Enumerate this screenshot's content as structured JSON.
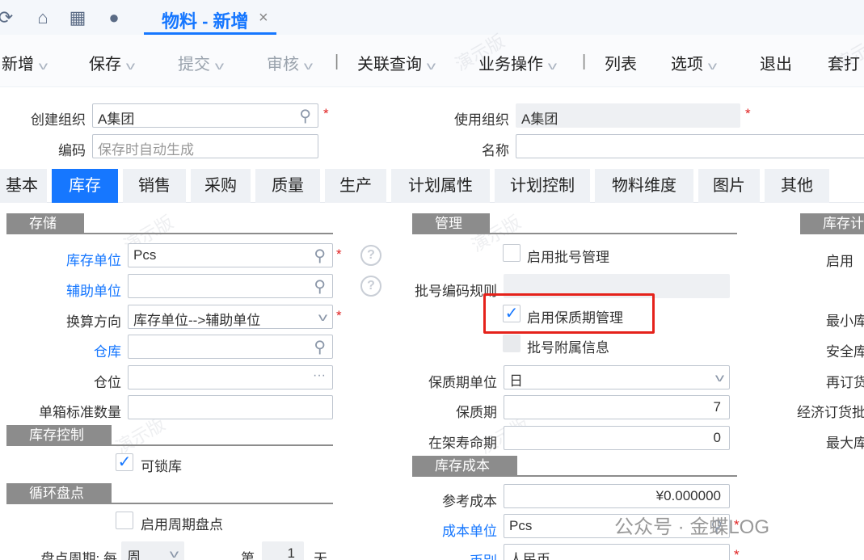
{
  "topbar": {
    "icons": [
      "refresh-icon",
      "home-icon",
      "apps-icon",
      "message-icon"
    ],
    "tab_title": "物料 - 新增",
    "tab_close": "×"
  },
  "toolbar": {
    "new": "新增",
    "save": "保存",
    "submit": "提交",
    "audit": "审核",
    "related_query": "关联查询",
    "business_ops": "业务操作",
    "list": "列表",
    "options": "选项",
    "exit": "退出",
    "print": "套打"
  },
  "header_form": {
    "create_org_label": "创建组织",
    "create_org_value": "A集团",
    "use_org_label": "使用组织",
    "use_org_value": "A集团",
    "code_label": "编码",
    "code_placeholder": "保存时自动生成",
    "name_label": "名称",
    "name_value": ""
  },
  "tabs": [
    "基本",
    "库存",
    "销售",
    "采购",
    "质量",
    "生产",
    "计划属性",
    "计划控制",
    "物料维度",
    "图片",
    "其他"
  ],
  "active_tab": "库存",
  "storage": {
    "title": "存储",
    "stock_unit_label": "库存单位",
    "stock_unit_value": "Pcs",
    "aux_unit_label": "辅助单位",
    "aux_unit_value": "",
    "convert_dir_label": "换算方向",
    "convert_dir_value": "库存单位-->辅助单位",
    "warehouse_label": "仓库",
    "warehouse_value": "",
    "location_label": "仓位",
    "location_value": "",
    "std_qty_label": "单箱标准数量",
    "std_qty_value": ""
  },
  "stock_control": {
    "title": "库存控制",
    "lockable_label": "可锁库",
    "lockable_checked": true
  },
  "cycle_count": {
    "title": "循环盘点",
    "enable_label": "启用周期盘点",
    "enable_checked": false,
    "period_label": "盘点周期: 每",
    "period_value": "周",
    "day_prefix": "第",
    "day_value": "1",
    "day_suffix": "天"
  },
  "management": {
    "title": "管理",
    "batch_mgmt_label": "启用批号管理",
    "batch_mgmt_checked": false,
    "batch_rule_label": "批号编码规则",
    "batch_rule_value": "",
    "shelf_mgmt_label": "启用保质期管理",
    "shelf_mgmt_checked": true,
    "batch_extra_label": "批号附属信息",
    "batch_extra_checked": false,
    "shelf_unit_label": "保质期单位",
    "shelf_unit_value": "日",
    "shelf_life_label": "保质期",
    "shelf_life_value": "7",
    "shelf_on_label": "在架寿命期",
    "shelf_on_value": "0"
  },
  "stock_cost": {
    "title": "库存成本",
    "ref_cost_label": "参考成本",
    "ref_cost_value": "¥0.000000",
    "cost_unit_label": "成本单位",
    "cost_unit_value": "Pcs",
    "currency_label": "币别",
    "currency_value": "人民币"
  },
  "plan_partial": {
    "title": "库存计",
    "enable_label": "启用",
    "min_label": "最小库",
    "safety_label": "安全库",
    "reorder_label": "再订货",
    "eoq_label": "经济订货批",
    "max_label": "最大库"
  },
  "watermark": "演示版",
  "footer_watermark": "公众号 · 金蝶LOG"
}
